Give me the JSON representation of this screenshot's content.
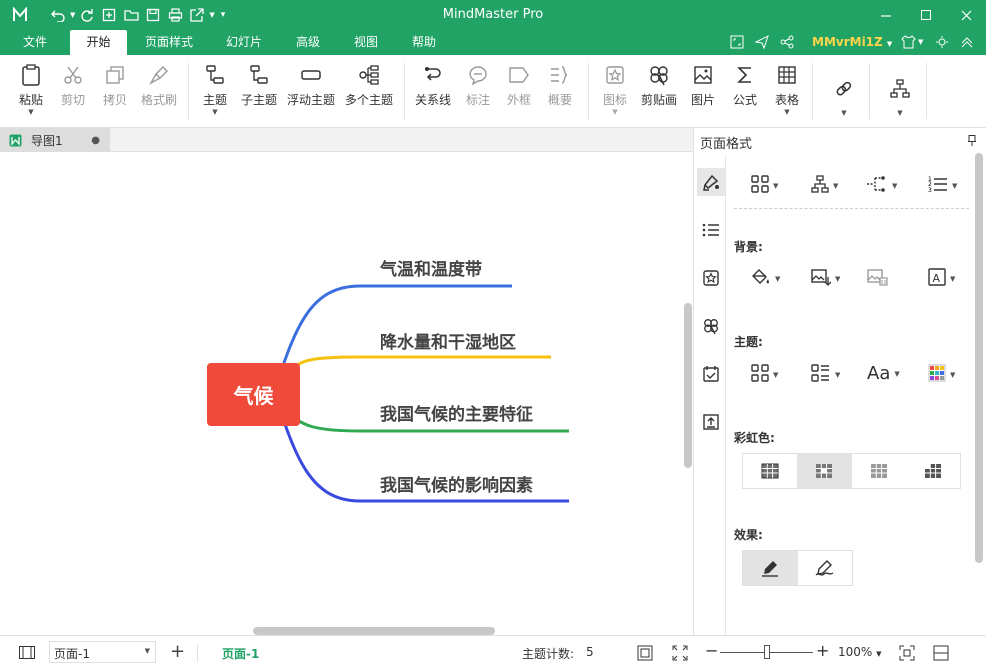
{
  "app": {
    "title": "MindMaster Pro"
  },
  "menu": {
    "tabs": [
      {
        "label": "文件"
      },
      {
        "label": "开始"
      },
      {
        "label": "页面样式"
      },
      {
        "label": "幻灯片"
      },
      {
        "label": "高级"
      },
      {
        "label": "视图"
      },
      {
        "label": "帮助"
      }
    ],
    "account": "MMvrMi1Z"
  },
  "ribbon": {
    "paste": "粘贴",
    "cut": "剪切",
    "copy": "拷贝",
    "format_painter": "格式刷",
    "topic": "主题",
    "subtopic": "子主题",
    "floating_topic": "浮动主题",
    "multi_topic": "多个主题",
    "relationship": "关系线",
    "callout": "标注",
    "boundary": "外框",
    "summary": "概要",
    "icon": "图标",
    "clipart": "剪贴画",
    "picture": "图片",
    "formula": "公式",
    "table": "表格"
  },
  "document": {
    "tab_name": "导图1"
  },
  "mindmap": {
    "central": "气候",
    "topics": [
      {
        "label": "气温和温度带",
        "color": "#3b6fe0"
      },
      {
        "label": "降水量和干湿地区",
        "color": "#f5c211"
      },
      {
        "label": "我国气候的主要特征",
        "color": "#2fa84f"
      },
      {
        "label": "我国气候的影响因素",
        "color": "#3a49e0"
      }
    ]
  },
  "panel": {
    "title": "页面格式",
    "sections": {
      "background": "背景:",
      "theme": "主题:",
      "rainbow": "彩虹色:",
      "effects": "效果:"
    }
  },
  "status": {
    "page_select": "页面-1",
    "add_page": "+",
    "current_page": "页面-1",
    "topic_count_label": "主题计数:",
    "topic_count": "5",
    "zoom": "100%",
    "zoom_level": 0.5
  },
  "colors": {
    "accent": "#21a366",
    "central": "#f04a3a"
  }
}
